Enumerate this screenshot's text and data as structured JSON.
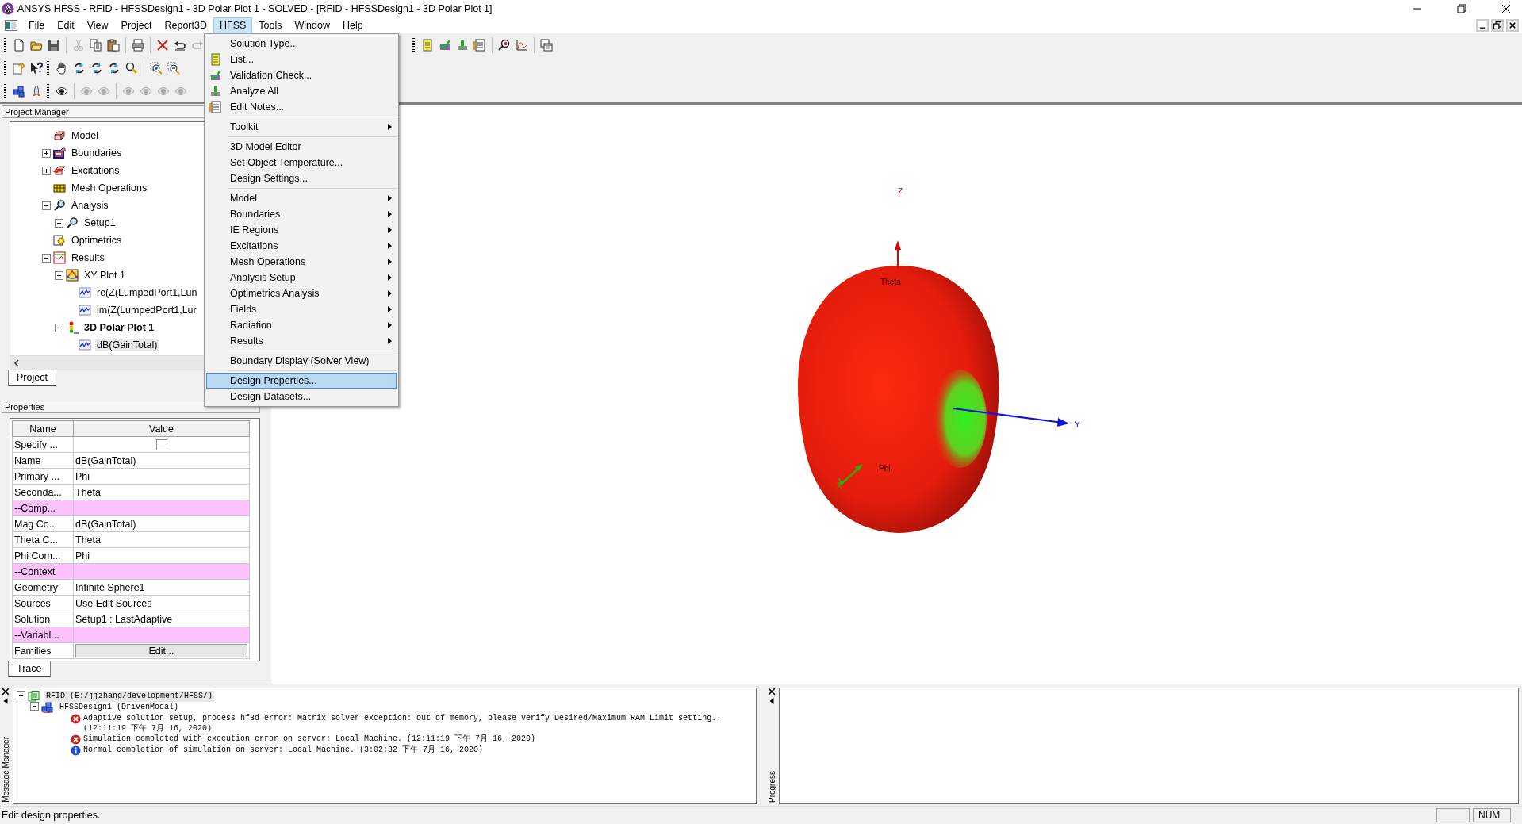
{
  "window": {
    "title": "ANSYS HFSS - RFID - HFSSDesign1 - 3D Polar Plot 1 - SOLVED - [RFID - HFSSDesign1 - 3D Polar Plot 1]"
  },
  "menu_bar": [
    {
      "label": "File",
      "selected": false
    },
    {
      "label": "Edit",
      "selected": false
    },
    {
      "label": "View",
      "selected": false
    },
    {
      "label": "Project",
      "selected": false
    },
    {
      "label": "Report3D",
      "selected": false
    },
    {
      "label": "HFSS",
      "selected": true
    },
    {
      "label": "Tools",
      "selected": false
    },
    {
      "label": "Window",
      "selected": false
    },
    {
      "label": "Help",
      "selected": false
    }
  ],
  "hfss_menu": {
    "groups": [
      [
        {
          "label": "Solution Type...",
          "submenu": false,
          "selected": false
        },
        {
          "label": "List...",
          "submenu": false,
          "selected": false
        },
        {
          "label": "Validation Check...",
          "submenu": false,
          "selected": false
        },
        {
          "label": "Analyze All",
          "submenu": false,
          "selected": false
        },
        {
          "label": "Edit Notes...",
          "submenu": false,
          "selected": false
        }
      ],
      [
        {
          "label": "Toolkit",
          "submenu": true,
          "selected": false
        }
      ],
      [
        {
          "label": "3D Model Editor",
          "submenu": false,
          "selected": false
        },
        {
          "label": "Set Object Temperature...",
          "submenu": false,
          "selected": false
        },
        {
          "label": "Design Settings...",
          "submenu": false,
          "selected": false
        }
      ],
      [
        {
          "label": "Model",
          "submenu": true,
          "selected": false
        },
        {
          "label": "Boundaries",
          "submenu": true,
          "selected": false
        },
        {
          "label": "IE Regions",
          "submenu": true,
          "selected": false
        },
        {
          "label": "Excitations",
          "submenu": true,
          "selected": false
        },
        {
          "label": "Mesh Operations",
          "submenu": true,
          "selected": false
        },
        {
          "label": "Analysis Setup",
          "submenu": true,
          "selected": false
        },
        {
          "label": "Optimetrics Analysis",
          "submenu": true,
          "selected": false
        },
        {
          "label": "Fields",
          "submenu": true,
          "selected": false
        },
        {
          "label": "Radiation",
          "submenu": true,
          "selected": false
        },
        {
          "label": "Results",
          "submenu": true,
          "selected": false
        }
      ],
      [
        {
          "label": "Boundary Display (Solver View)",
          "submenu": false,
          "selected": false
        }
      ],
      [
        {
          "label": "Design Properties...",
          "submenu": false,
          "selected": true
        },
        {
          "label": "Design Datasets...",
          "submenu": false,
          "selected": false
        }
      ]
    ]
  },
  "project_manager": {
    "title": "Project Manager",
    "tree": [
      {
        "label": "Model",
        "selected": false,
        "active": false
      },
      {
        "label": "Boundaries",
        "expanded": false,
        "selected": false,
        "active": false
      },
      {
        "label": "Excitations",
        "expanded": false,
        "selected": false,
        "active": false
      },
      {
        "label": "Mesh Operations",
        "selected": false,
        "active": false
      },
      {
        "label": "Analysis",
        "expanded": true,
        "selected": false,
        "active": false,
        "children": [
          {
            "label": "Setup1",
            "expanded": false,
            "selected": false,
            "active": false
          }
        ]
      },
      {
        "label": "Optimetrics",
        "selected": false,
        "active": false
      },
      {
        "label": "Results",
        "expanded": true,
        "selected": false,
        "active": false,
        "children": [
          {
            "label": "XY Plot 1",
            "expanded": true,
            "selected": false,
            "active": false,
            "children": [
              {
                "label": "re(Z(LumpedPort1,Lun",
                "selected": false,
                "active": false
              },
              {
                "label": "im(Z(LumpedPort1,Lur",
                "selected": false,
                "active": false
              }
            ]
          },
          {
            "label": "3D Polar Plot 1",
            "expanded": true,
            "selected": false,
            "active": true,
            "children": [
              {
                "label": "dB(GainTotal)",
                "selected": true,
                "active": false
              }
            ]
          }
        ]
      }
    ],
    "tabs": [
      {
        "label": "Project",
        "selected": true
      }
    ]
  },
  "properties": {
    "title": "Properties",
    "columns": [
      "Name",
      "Value"
    ],
    "rows": [
      {
        "kind": "checkbox",
        "name": "Specify ...",
        "checked": false
      },
      {
        "kind": "text",
        "name": "Name",
        "value": "dB(GainTotal)"
      },
      {
        "kind": "text",
        "name": "Primary ...",
        "value": "Phi"
      },
      {
        "kind": "text",
        "name": "Seconda...",
        "value": "Theta"
      },
      {
        "kind": "section",
        "name": "--Comp..."
      },
      {
        "kind": "text",
        "name": "Mag Co...",
        "value": "dB(GainTotal)"
      },
      {
        "kind": "text",
        "name": "Theta C...",
        "value": "Theta"
      },
      {
        "kind": "text",
        "name": "Phi Com...",
        "value": "Phi"
      },
      {
        "kind": "section",
        "name": "--Context"
      },
      {
        "kind": "text",
        "name": "Geometry",
        "value": "Infinite Sphere1"
      },
      {
        "kind": "text",
        "name": "Sources",
        "value": "Use Edit Sources"
      },
      {
        "kind": "text",
        "name": "Solution",
        "value": "Setup1 : LastAdaptive"
      },
      {
        "kind": "section",
        "name": "--Variabl..."
      },
      {
        "kind": "button",
        "name": "Families",
        "button": "Edit..."
      }
    ],
    "tabs": [
      {
        "label": "Trace",
        "selected": true
      }
    ]
  },
  "plot_3d": {
    "z_label": "Z",
    "y_label": "Y",
    "phi_label": "Phi",
    "x_label": "X",
    "theta_label": "Theta"
  },
  "message_manager": {
    "title": "Message Manager",
    "tree": [
      {
        "text": "RFID (E:/jjzhang/development/HFSS/)",
        "expanded": true,
        "selected": true,
        "children": [
          {
            "text": "HFSSDesign1 (DrivenModal)",
            "expanded": true,
            "selected": false,
            "messages": [
              {
                "kind": "error",
                "lines": [
                  "Adaptive solution setup, process hf3d error: Matrix solver exception: out of memory, please verify Desired/Maximum RAM Limit setting..",
                  "(12:11:19 下午  7月 16, 2020)"
                ]
              },
              {
                "kind": "error",
                "lines": [
                  "Simulation completed with execution error on server: Local Machine. (12:11:19 下午  7月 16, 2020)"
                ]
              },
              {
                "kind": "info",
                "lines": [
                  "Normal completion of simulation on server: Local Machine. (3:02:32 下午  7月 16, 2020)"
                ]
              }
            ]
          }
        ]
      }
    ]
  },
  "progress": {
    "title": "Progress"
  },
  "status_bar": {
    "text": "Edit design properties.",
    "indicator": "NUM"
  }
}
